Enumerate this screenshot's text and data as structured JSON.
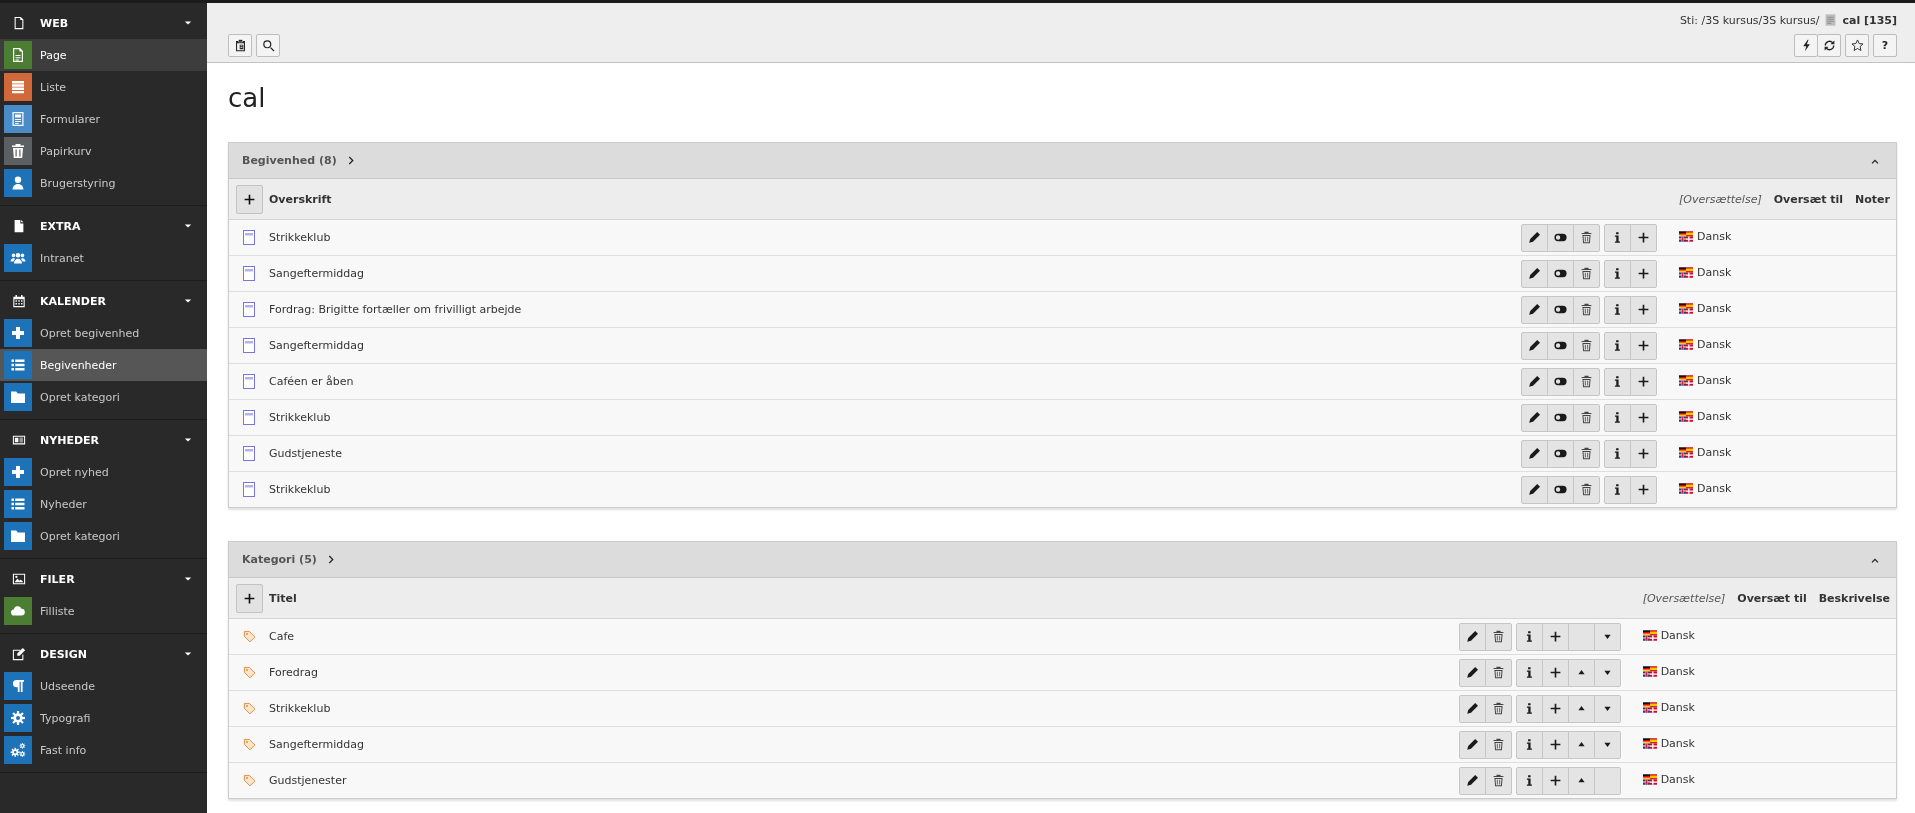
{
  "sidebar": {
    "groups": [
      {
        "title": "WEB",
        "expanded": true,
        "items": [
          {
            "label": "Page",
            "color": "#4b7d33",
            "selected": false,
            "hovered": true
          },
          {
            "label": "Liste",
            "color": "#d1683a",
            "selected": false,
            "hovered": false
          },
          {
            "label": "Formularer",
            "color": "#4a8bc9",
            "selected": false,
            "hovered": false
          },
          {
            "label": "Papirkurv",
            "color": "#5c6063",
            "selected": false,
            "hovered": false
          },
          {
            "label": "Brugerstyring",
            "color": "#1d72b8",
            "selected": false,
            "hovered": false
          }
        ]
      },
      {
        "title": "EXTRA",
        "expanded": true,
        "items": [
          {
            "label": "Intranet",
            "color": "#1d72b8",
            "selected": false,
            "hovered": false
          }
        ]
      },
      {
        "title": "KALENDER",
        "expanded": true,
        "items": [
          {
            "label": "Opret begivenhed",
            "color": "#1d72b8",
            "selected": false,
            "hovered": false
          },
          {
            "label": "Begivenheder",
            "color": "#1d72b8",
            "selected": true,
            "hovered": false
          },
          {
            "label": "Opret kategori",
            "color": "#1d72b8",
            "selected": false,
            "hovered": false
          }
        ]
      },
      {
        "title": "NYHEDER",
        "expanded": true,
        "items": [
          {
            "label": "Opret nyhed",
            "color": "#1d72b8",
            "selected": false,
            "hovered": false
          },
          {
            "label": "Nyheder",
            "color": "#1d72b8",
            "selected": false,
            "hovered": false
          },
          {
            "label": "Opret kategori",
            "color": "#1d72b8",
            "selected": false,
            "hovered": false
          }
        ]
      },
      {
        "title": "FILER",
        "expanded": true,
        "items": [
          {
            "label": "Filliste",
            "color": "#4b7d33",
            "selected": false,
            "hovered": false
          }
        ]
      },
      {
        "title": "DESIGN",
        "expanded": true,
        "items": [
          {
            "label": "Udseende",
            "color": "#1d72b8",
            "selected": false,
            "hovered": false
          },
          {
            "label": "Typografi",
            "color": "#1d72b8",
            "selected": false,
            "hovered": false
          },
          {
            "label": "Fast info",
            "color": "#1d72b8",
            "selected": false,
            "hovered": false
          }
        ]
      }
    ]
  },
  "docheader": {
    "path": "Sti: /3S kursus/3S kursus/",
    "page": "cal [135]",
    "help": "?"
  },
  "title": "cal",
  "sections": [
    {
      "kind": "event",
      "title": "Begivenhed (8)",
      "expanded": true,
      "columns": {
        "main": "Overskrift",
        "translation": "[Oversættelse]",
        "translate_to": "Oversæt til",
        "extra": "Noter"
      },
      "rows": [
        {
          "title": "Strikkeklub",
          "language": "Dansk"
        },
        {
          "title": "Sangeftermiddag",
          "language": "Dansk"
        },
        {
          "title": "Fordrag: Brigitte fortæller om frivilligt arbejde",
          "language": "Dansk"
        },
        {
          "title": "Sangeftermiddag",
          "language": "Dansk"
        },
        {
          "title": "Caféen er åben",
          "language": "Dansk"
        },
        {
          "title": "Strikkeklub",
          "language": "Dansk"
        },
        {
          "title": "Gudstjeneste",
          "language": "Dansk"
        },
        {
          "title": "Strikkeklub",
          "language": "Dansk"
        }
      ]
    },
    {
      "kind": "category",
      "title": "Kategori (5)",
      "expanded": true,
      "columns": {
        "main": "Titel",
        "translation": "[Oversættelse]",
        "translate_to": "Oversæt til",
        "extra": "Beskrivelse"
      },
      "rows": [
        {
          "title": "Cafe",
          "language": "Dansk",
          "move_up": false,
          "move_down": true
        },
        {
          "title": "Foredrag",
          "language": "Dansk",
          "move_up": true,
          "move_down": true
        },
        {
          "title": "Strikkeklub",
          "language": "Dansk",
          "move_up": true,
          "move_down": true
        },
        {
          "title": "Sangeftermiddag",
          "language": "Dansk",
          "move_up": true,
          "move_down": true
        },
        {
          "title": "Gudstjenester",
          "language": "Dansk",
          "move_up": true,
          "move_down": false
        }
      ]
    }
  ]
}
